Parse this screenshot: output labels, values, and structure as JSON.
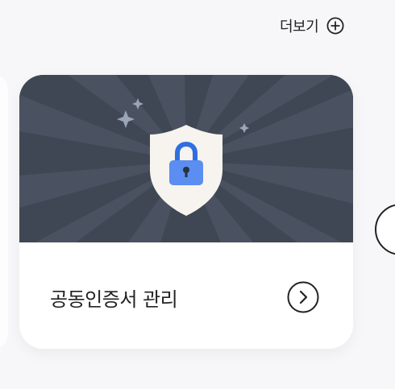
{
  "header": {
    "more_label": "더보기",
    "more_icon": "plus-circle-icon"
  },
  "card": {
    "title": "공동인증서 관리",
    "arrow_icon": "chevron-right-circle-icon",
    "hero_icon": "shield-lock-icon",
    "colors": {
      "hero_bg": "#3f4754",
      "ray_light": "#4a5262",
      "ray_dark": "#394150",
      "shield": "#f7f3ee",
      "lock_body": "#5b8ef0",
      "lock_shackle": "#2f6fe0",
      "sparkle": "#9aa6b8"
    }
  }
}
